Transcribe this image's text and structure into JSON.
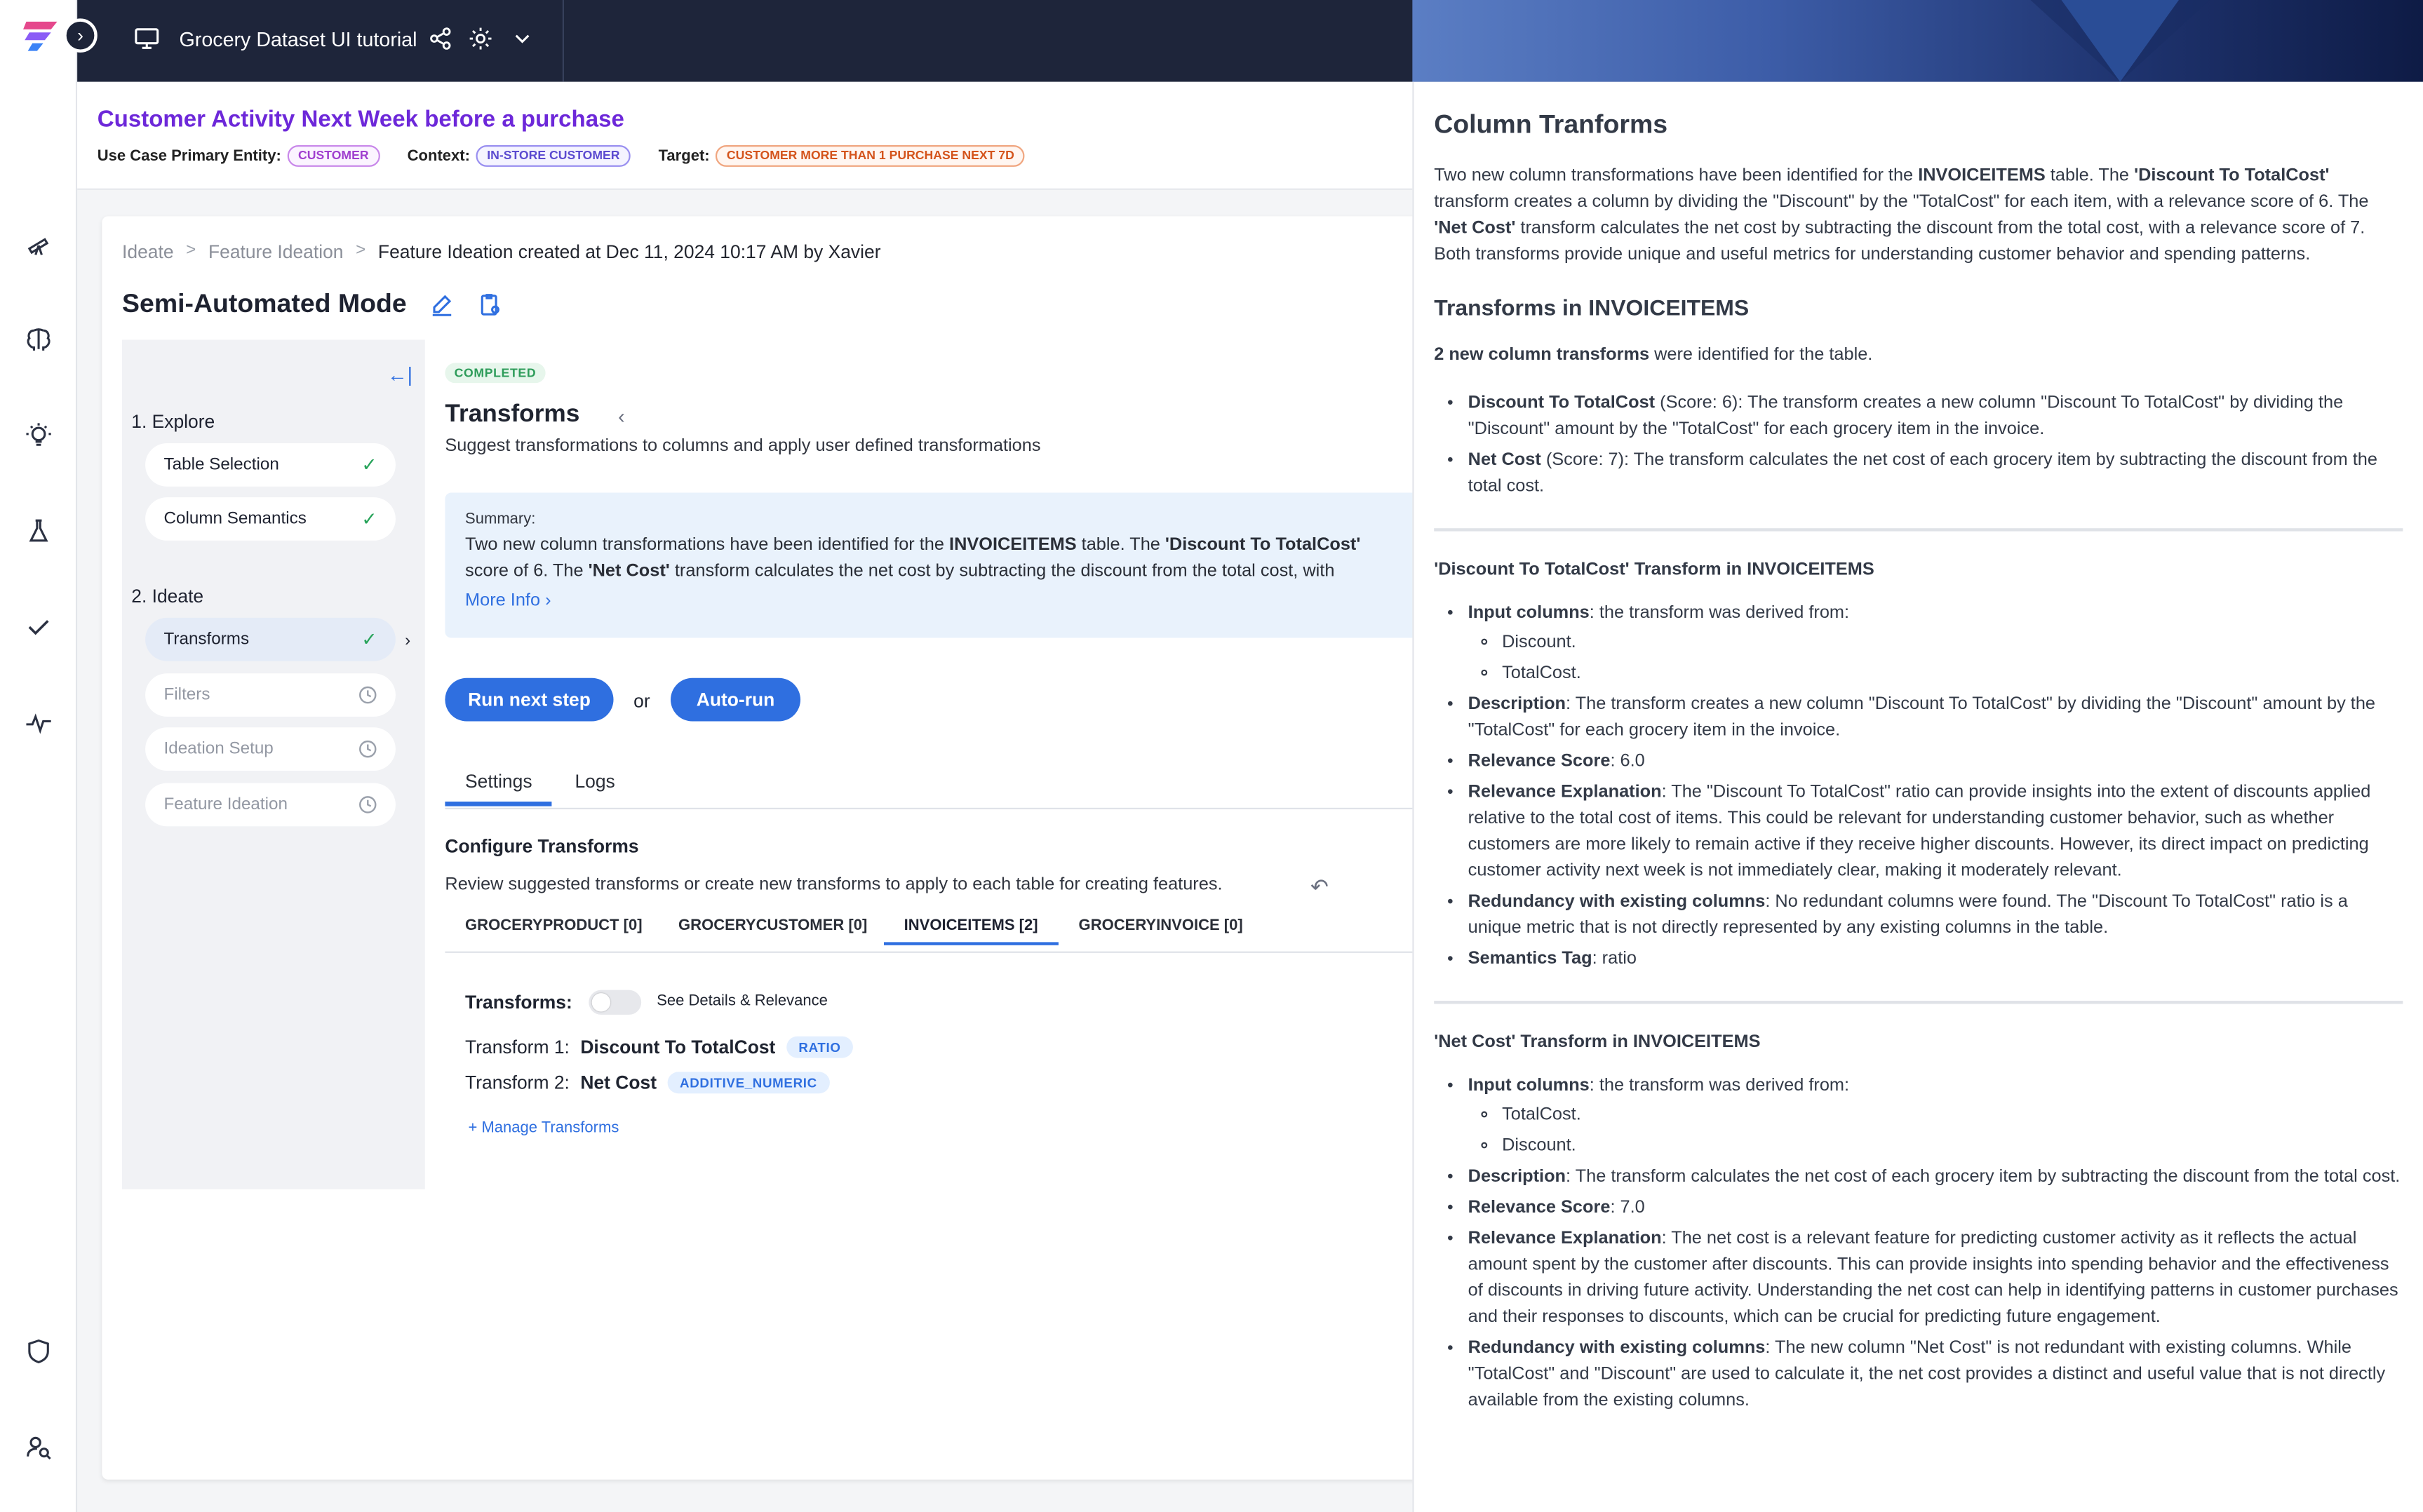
{
  "header": {
    "workspace_title": "Grocery Dataset UI tutorial"
  },
  "usecase": {
    "title": "Customer Activity Next Week before a purchase",
    "entity_label": "Use Case Primary Entity:",
    "entity_value": "CUSTOMER",
    "context_label": "Context:",
    "context_value": "IN-STORE CUSTOMER",
    "target_label": "Target:",
    "target_value": "CUSTOMER MORE THAN 1 PURCHASE NEXT 7D"
  },
  "breadcrumb": {
    "items": [
      "Ideate",
      "Feature Ideation"
    ],
    "current": "Feature Ideation created at Dec 11, 2024 10:17 AM by Xavier"
  },
  "mode_title": "Semi-Automated Mode",
  "steps": {
    "explore_label": "1. Explore",
    "ideate_label": "2. Ideate",
    "items": [
      {
        "label": "Table Selection"
      },
      {
        "label": "Column Semantics"
      },
      {
        "label": "Transforms"
      },
      {
        "label": "Filters"
      },
      {
        "label": "Ideation Setup"
      },
      {
        "label": "Feature Ideation"
      }
    ]
  },
  "content": {
    "status": "COMPLETED",
    "title": "Transforms",
    "subtitle": "Suggest transformations to columns and apply user defined transformations",
    "summary_label": "Summary:",
    "summary_line1_a": "Two new column transformations have been identified for the ",
    "summary_line1_b": "INVOICEITEMS",
    "summary_line1_c": " table. The ",
    "summary_line1_d": "'Discount To TotalCost'",
    "summary_line2_a": "score of 6. The ",
    "summary_line2_b": "'Net Cost'",
    "summary_line2_c": " transform calculates the net cost by subtracting the discount from the total cost, with",
    "more_info": "More Info",
    "run_next": "Run next step",
    "or": "or",
    "auto_run": "Auto-run",
    "tabs": [
      "Settings",
      "Logs"
    ],
    "configure_title": "Configure Transforms",
    "configure_sub": "Review suggested transforms or create new transforms to apply to each table for creating features.",
    "table_tabs": [
      "GROCERYPRODUCT [0]",
      "GROCERYCUSTOMER [0]",
      "INVOICEITEMS [2]",
      "GROCERYINVOICE [0]"
    ],
    "transforms_label": "Transforms:",
    "toggle_label": "See Details & Relevance",
    "transforms": [
      {
        "prefix": "Transform 1:",
        "name": "Discount To TotalCost",
        "tag": "RATIO"
      },
      {
        "prefix": "Transform 2:",
        "name": "Net Cost",
        "tag": "ADDITIVE_NUMERIC"
      }
    ],
    "manage": "Manage Transforms"
  },
  "panel": {
    "title": "Column Tranforms",
    "intro_a": "Two new column transformations have been identified for the ",
    "intro_b": "INVOICEITEMS",
    "intro_c": " table. The ",
    "intro_d": "'Discount To TotalCost'",
    "intro_e": " transform creates a column by dividing the \"Discount\" by the \"TotalCost\" for each item, with a relevance score of 6. The ",
    "intro_f": "'Net Cost'",
    "intro_g": " transform calculates the net cost by subtracting the discount from the total cost, with a relevance score of 7. Both transforms provide unique and useful metrics for understanding customer behavior and spending patterns.",
    "section_title": "Transforms in INVOICEITEMS",
    "count_b": "2 new column transforms",
    "count_rest": " were identified for the table.",
    "bullets": [
      {
        "bold": "Discount To TotalCost",
        "rest": " (Score: 6): The transform creates a new column \"Discount To TotalCost\" by dividing the \"Discount\" amount by the \"TotalCost\" for each grocery item in the invoice."
      },
      {
        "bold": "Net Cost",
        "rest": " (Score: 7): The transform calculates the net cost of each grocery item by subtracting the discount from the total cost."
      }
    ],
    "t1": {
      "heading": "'Discount To TotalCost' Transform in INVOICEITEMS",
      "input_label": "Input columns",
      "input_rest": ": the transform was derived from:",
      "inputs": [
        "Discount.",
        "TotalCost."
      ],
      "desc_label": "Description",
      "desc": ": The transform creates a new column \"Discount To TotalCost\" by dividing the \"Discount\" amount by the \"TotalCost\" for each grocery item in the invoice.",
      "score_label": "Relevance Score",
      "score": ": 6.0",
      "expl_label": "Relevance Explanation",
      "expl": ": The \"Discount To TotalCost\" ratio can provide insights into the extent of discounts applied relative to the total cost of items. This could be relevant for understanding customer behavior, such as whether customers are more likely to remain active if they receive higher discounts. However, its direct impact on predicting customer activity next week is not immediately clear, making it moderately relevant.",
      "red_label": "Redundancy with existing columns",
      "red": ": No redundant columns were found. The \"Discount To TotalCost\" ratio is a unique metric that is not directly represented by any existing columns in the table.",
      "tag_label": "Semantics Tag",
      "tag": ": ratio"
    },
    "t2": {
      "heading": "'Net Cost' Transform in INVOICEITEMS",
      "input_label": "Input columns",
      "input_rest": ": the transform was derived from:",
      "inputs": [
        "TotalCost.",
        "Discount."
      ],
      "desc_label": "Description",
      "desc": ": The transform calculates the net cost of each grocery item by subtracting the discount from the total cost.",
      "score_label": "Relevance Score",
      "score": ": 7.0",
      "expl_label": "Relevance Explanation",
      "expl": ": The net cost is a relevant feature for predicting customer activity as it reflects the actual amount spent by the customer after discounts. This can provide insights into spending behavior and the effectiveness of discounts in driving future activity. Understanding the net cost can help in identifying patterns in customer purchases and their responses to discounts, which can be crucial for predicting future engagement.",
      "red_label": "Redundancy with existing columns",
      "red": ": The new column \"Net Cost\" is not redundant with existing columns. While \"TotalCost\" and \"Discount\" are used to calculate it, the net cost provides a distinct and useful value that is not directly available from the existing columns."
    }
  }
}
